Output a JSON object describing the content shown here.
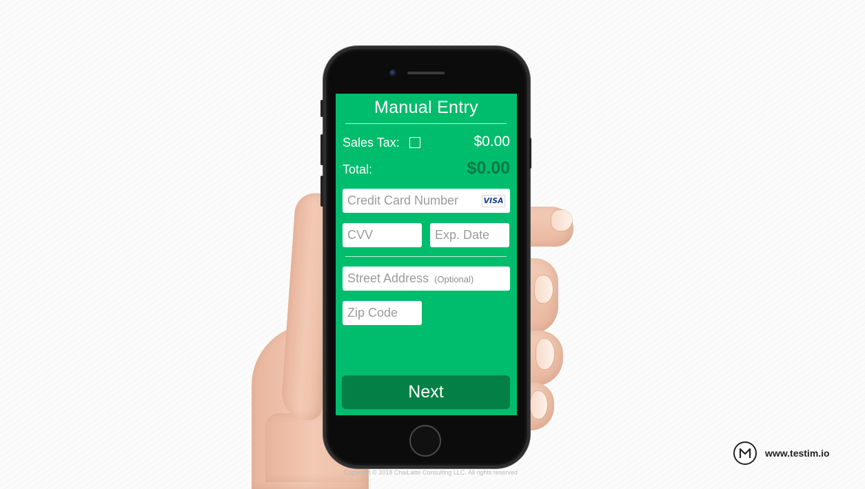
{
  "screen": {
    "title": "Manual Entry",
    "sales_tax": {
      "label": "Sales Tax:",
      "checked": false,
      "amount": "$0.00"
    },
    "total": {
      "label": "Total:",
      "amount": "$0.00"
    },
    "fields": {
      "credit_card_number": {
        "placeholder": "Credit Card Number",
        "card_brand": "VISA"
      },
      "cvv": {
        "placeholder": "CVV"
      },
      "exp_date": {
        "placeholder": "Exp. Date"
      },
      "street_address": {
        "placeholder": "Street Address",
        "hint": "(Optional)"
      },
      "zip_code": {
        "placeholder": "Zip Code"
      }
    },
    "next_label": "Next",
    "colors": {
      "background": "#00bd6d",
      "button": "#038046",
      "total_amount": "#0a7a45"
    }
  },
  "footer": {
    "copyright": "Copyright © 2018 ChaiLatte Consulting LLC. All rights reserved"
  },
  "brand": {
    "url": "www.testim.io",
    "logo_icon": "testim-logo-icon"
  }
}
